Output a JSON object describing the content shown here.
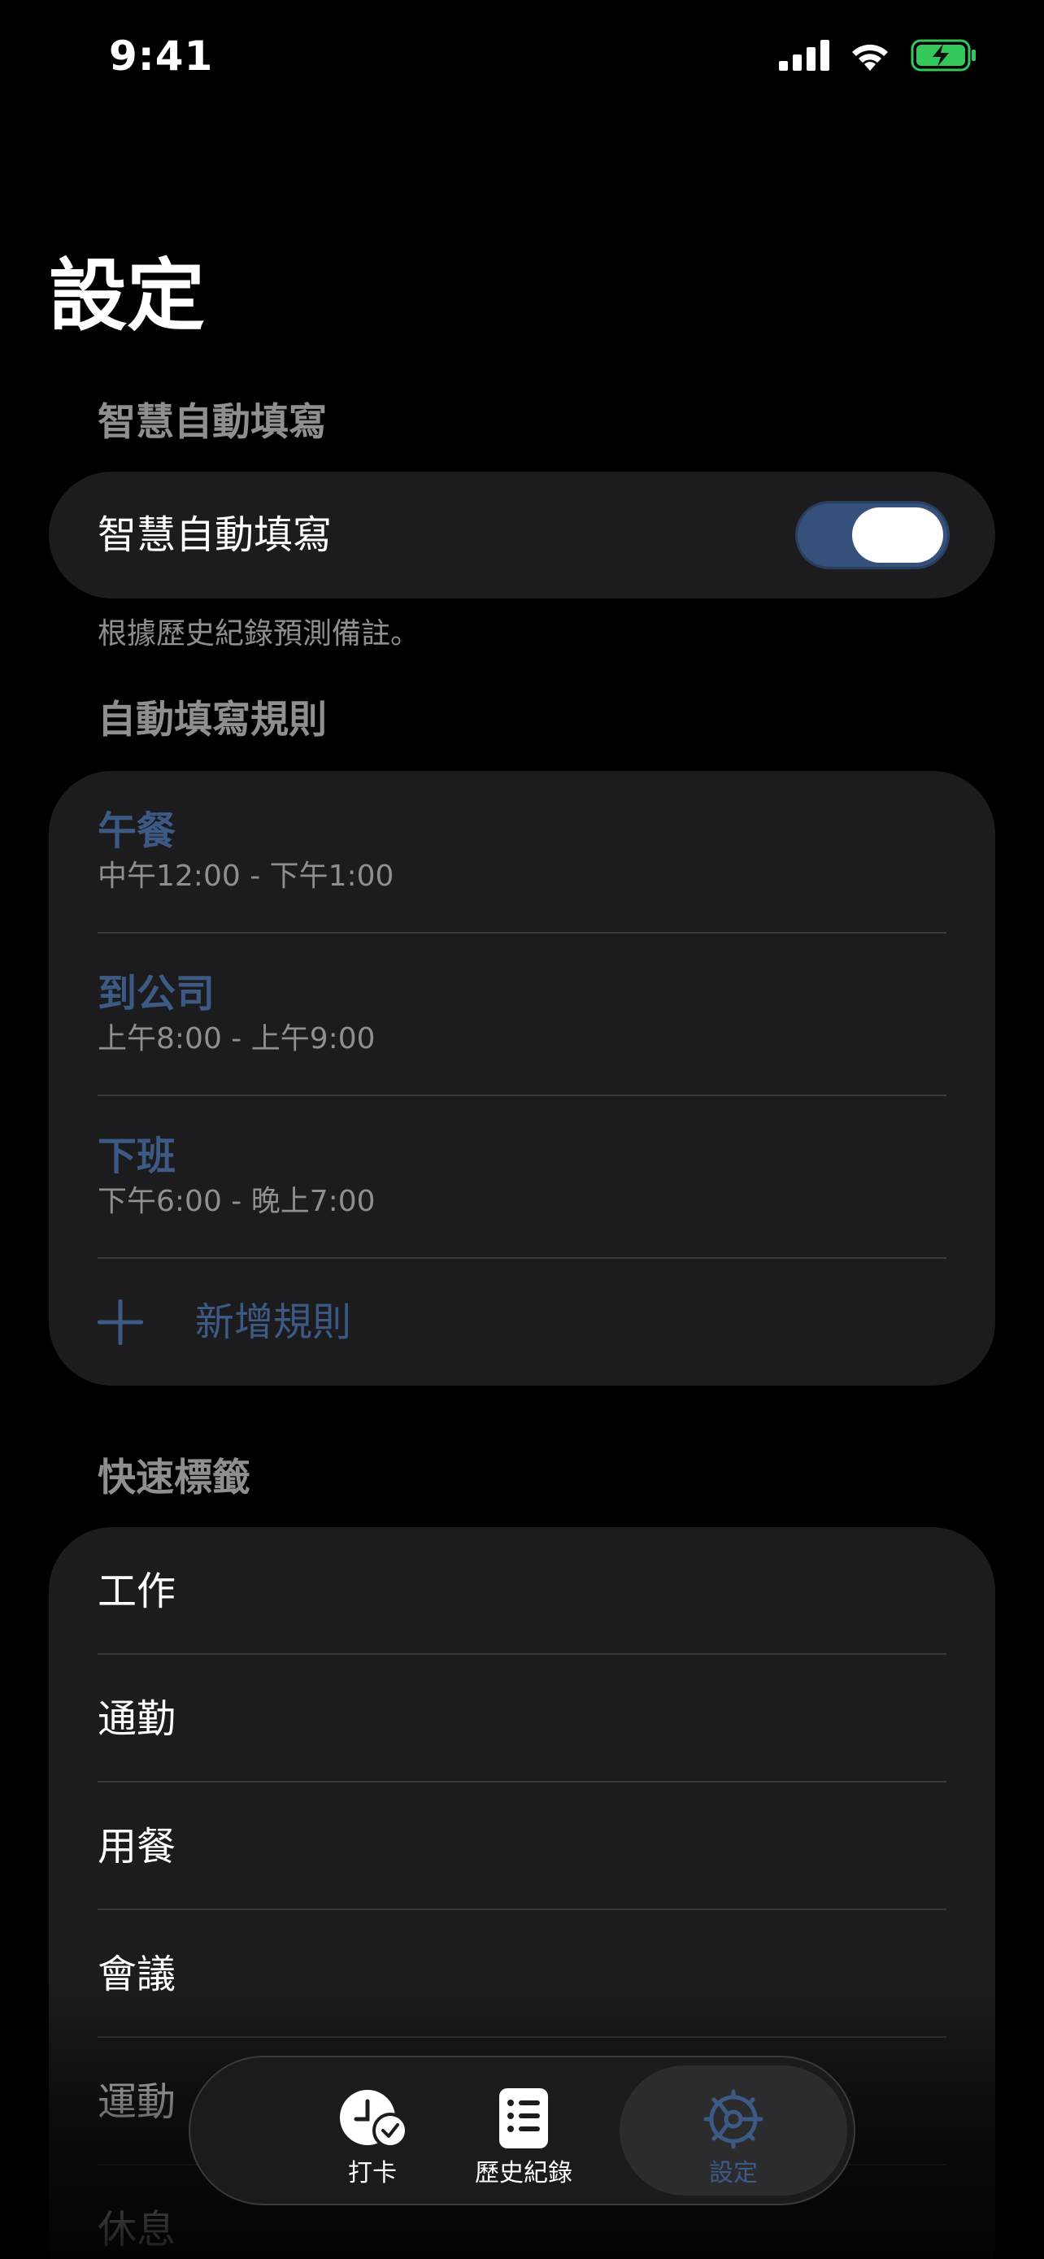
{
  "status_bar": {
    "time": "9:41"
  },
  "page_title": "設定",
  "smart_fill": {
    "header": "智慧自動填寫",
    "toggle_label": "智慧自動填寫",
    "toggle_on": true,
    "footnote": "根據歷史紀錄預測備註。"
  },
  "rules": {
    "header": "自動填寫規則",
    "items": [
      {
        "name": "午餐",
        "time": "中午12:00 - 下午1:00"
      },
      {
        "name": "到公司",
        "time": "上午8:00 - 上午9:00"
      },
      {
        "name": "下班",
        "time": "下午6:00 - 晚上7:00"
      }
    ],
    "add_label": "新增規則"
  },
  "tags": {
    "header": "快速標籤",
    "items": [
      "工作",
      "通勤",
      "用餐",
      "會議",
      "運動",
      "休息"
    ]
  },
  "tab_bar": {
    "tabs": [
      {
        "label": "打卡",
        "icon": "clock-check-icon"
      },
      {
        "label": "歷史紀錄",
        "icon": "list-icon"
      },
      {
        "label": "設定",
        "icon": "gear-icon"
      }
    ],
    "selected_index": 2
  },
  "colors": {
    "accent": "#3d5a85",
    "toggle_track": "#35507a",
    "card": "#1c1c1e",
    "secondary_text": "#8e8e93",
    "battery": "#34c759"
  }
}
